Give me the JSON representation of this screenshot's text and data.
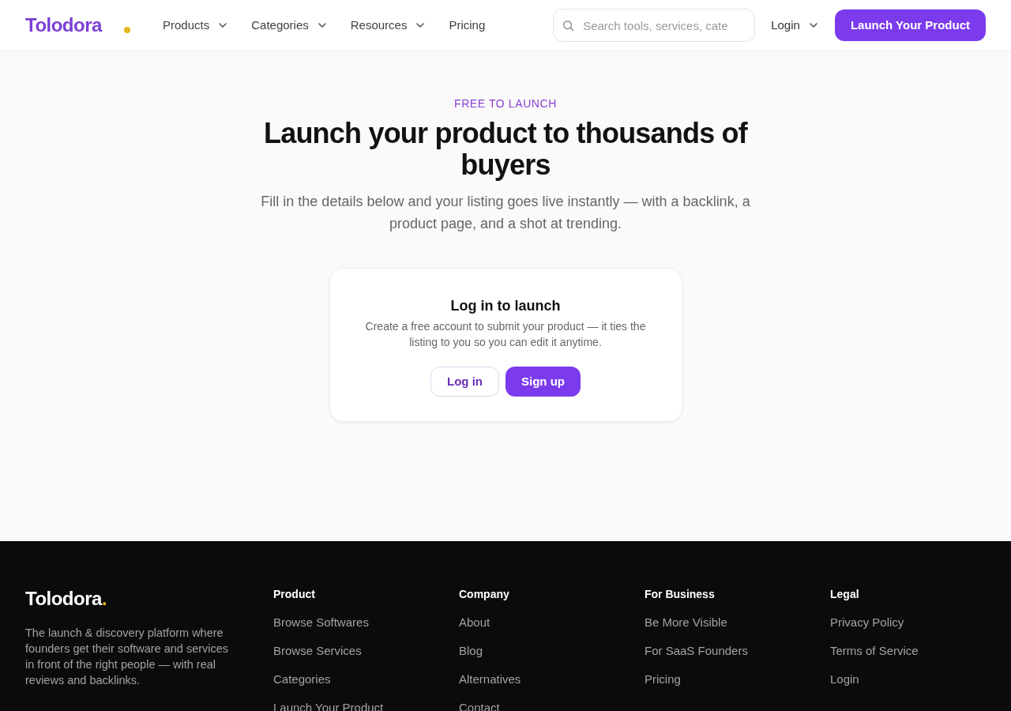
{
  "header": {
    "logo": {
      "name": "Tolodora"
    },
    "nav": [
      {
        "label": "Products",
        "dropdown": true
      },
      {
        "label": "Categories",
        "dropdown": true
      },
      {
        "label": "Resources",
        "dropdown": true
      },
      {
        "label": "Pricing",
        "dropdown": false
      }
    ],
    "search": {
      "placeholder": "Search tools, services, cate"
    },
    "login": {
      "label": "Login",
      "dropdown": true
    },
    "cta": {
      "label": "Launch Your Product"
    }
  },
  "hero": {
    "eyebrow": "FREE TO LAUNCH",
    "title": "Launch your product to thousands of buyers",
    "subtitle": "Fill in the details below and your listing goes live instantly — with a backlink, a product page, and a shot at trending."
  },
  "login_card": {
    "title": "Log in to launch",
    "text": "Create a free account to submit your product — it ties the listing to you so you can edit it anytime.",
    "buttons": [
      {
        "label": "Log in",
        "kind": "outline"
      },
      {
        "label": "Sign up",
        "kind": "primary"
      }
    ]
  },
  "footer": {
    "brand": {
      "name": "Tolodora",
      "dot": "."
    },
    "description": "The launch & discovery platform where founders get their software and services in front of the right people — with real reviews and backlinks.",
    "columns": [
      {
        "heading": "Product",
        "links": [
          "Browse Softwares",
          "Browse Services",
          "Categories",
          "Launch Your Product"
        ]
      },
      {
        "heading": "Company",
        "links": [
          "About",
          "Blog",
          "Alternatives",
          "Contact"
        ]
      },
      {
        "heading": "For Business",
        "links": [
          "Be More Visible",
          "For SaaS Founders",
          "Pricing"
        ]
      },
      {
        "heading": "Legal",
        "links": [
          "Privacy Policy",
          "Terms of Service",
          "Login"
        ]
      }
    ]
  }
}
